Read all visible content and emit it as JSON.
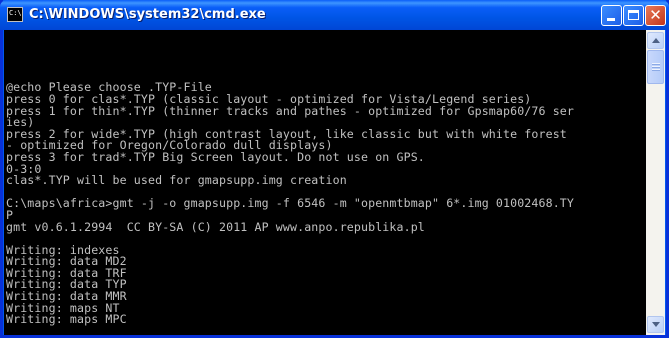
{
  "window": {
    "title": "C:\\WINDOWS\\system32\\cmd.exe",
    "icon": "cmd-icon",
    "icon_text": "C:\\"
  },
  "titlebar_buttons": {
    "minimize": "minimize-icon",
    "maximize": "maximize-icon",
    "close_glyph": "✕"
  },
  "console": {
    "lines": [
      "",
      "",
      "",
      "",
      "@echo Please choose .TYP-File",
      "press 0 for clas*.TYP (classic layout - optimized for Vista/Legend series)",
      "press 1 for thin*.TYP (thinner tracks and pathes - optimized for Gpsmap60/76 ser",
      "ies)",
      "press 2 for wide*.TYP (high contrast layout, like classic but with white forest",
      "- optimized for Oregon/Colorado dull displays)",
      "press 3 for trad*.TYP Big Screen layout. Do not use on GPS.",
      "0-3:0",
      "clas*.TYP will be used for gmapsupp.img creation",
      "",
      "C:\\maps\\africa>gmt -j -o gmapsupp.img -f 6546 -m \"openmtbmap\" 6*.img 01002468.TY",
      "P",
      "gmt v0.6.1.2994  CC BY-SA (C) 2011 AP www.anpo.republika.pl",
      "",
      "Writing: indexes",
      "Writing: data MD2",
      "Writing: data TRF",
      "Writing: data TYP",
      "Writing: data MMR",
      "Writing: maps NT",
      "Writing: maps MPC"
    ],
    "text_color": "#c0c0c0",
    "background": "#000000"
  },
  "scrollbar": {
    "up": "scroll-up-arrow-icon",
    "down": "scroll-down-arrow-icon"
  }
}
